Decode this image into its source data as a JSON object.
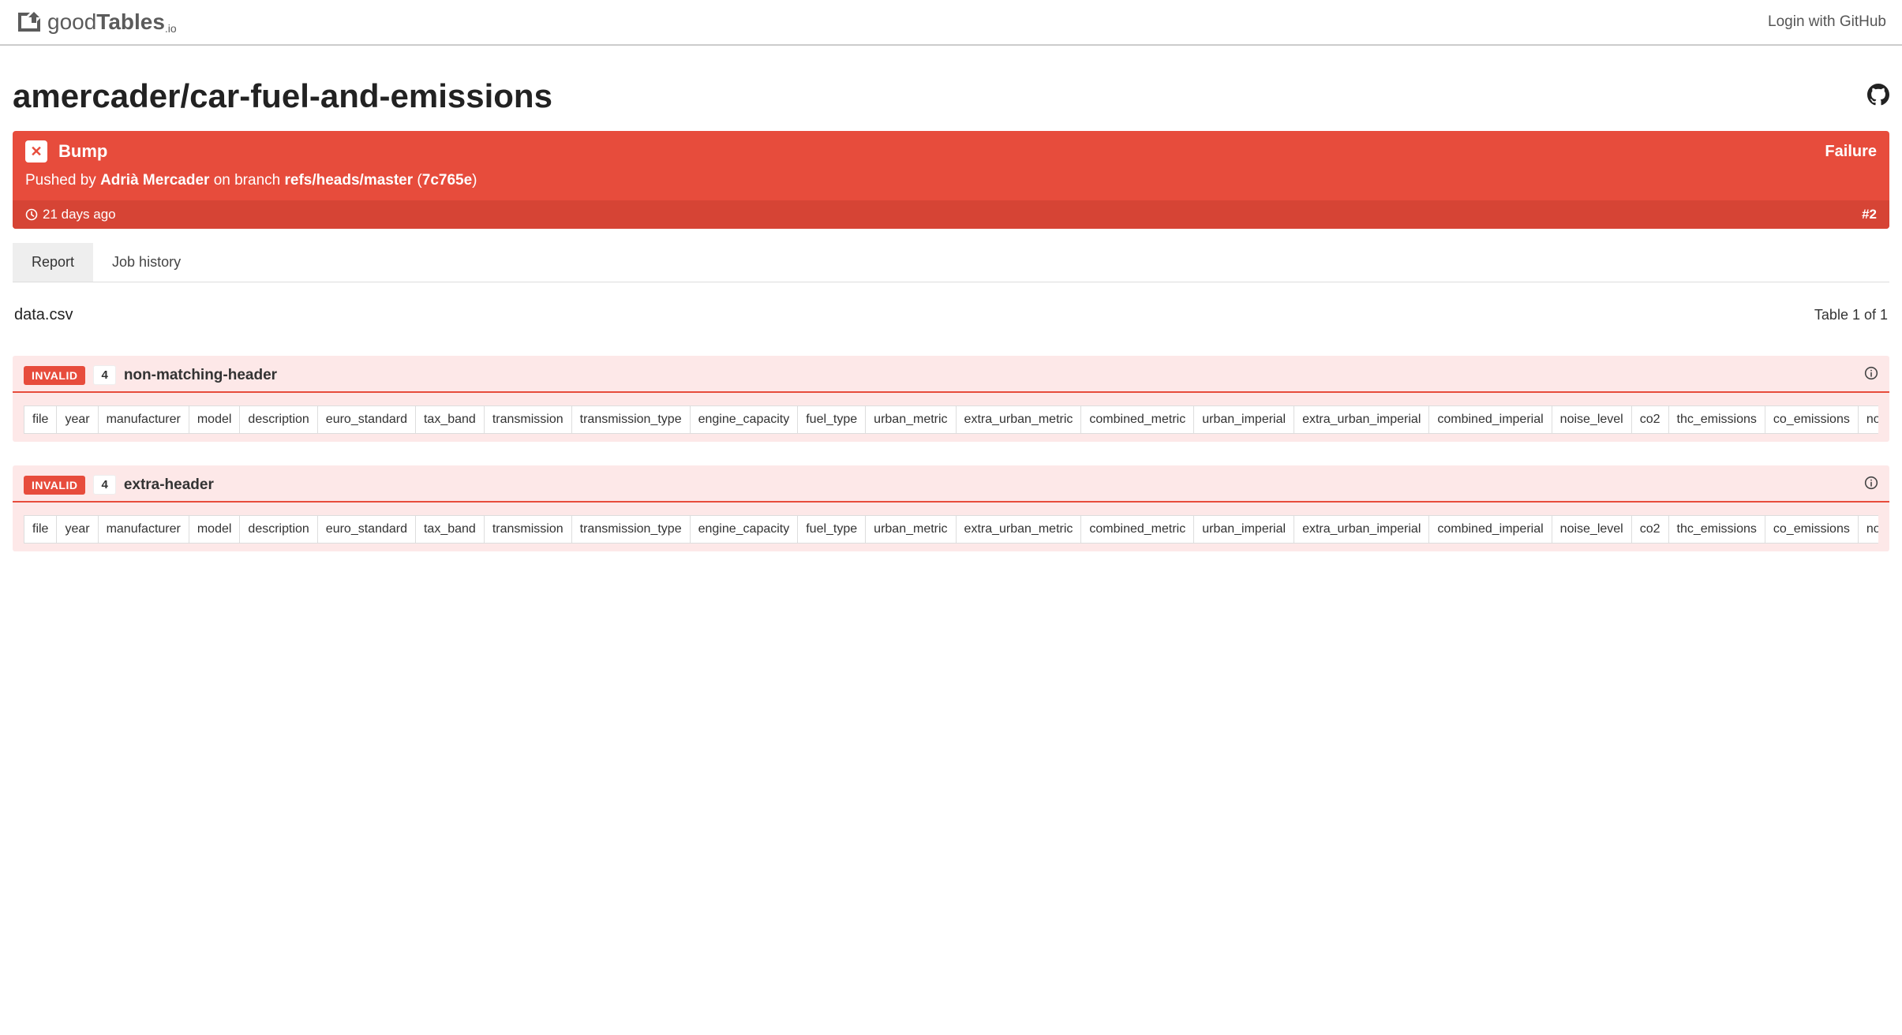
{
  "header": {
    "logo_text_prefix": "good",
    "logo_text_bold": "Tables",
    "logo_sub": ".io",
    "login": "Login with GitHub"
  },
  "repo": {
    "title": "amercader/car-fuel-and-emissions"
  },
  "status": {
    "commit_message": "Bump",
    "result": "Failure",
    "pushed_by_prefix": "Pushed by ",
    "author": "Adrià Mercader",
    "branch_prefix": " on branch ",
    "branch": "refs/heads/master",
    "sha_open": " (",
    "sha": "7c765e",
    "sha_close": ")",
    "time_ago": "21 days ago",
    "job_number": "#2"
  },
  "tabs": {
    "report": "Report",
    "history": "Job history"
  },
  "report": {
    "file": "data.csv",
    "table_of": "Table 1 of 1"
  },
  "errors": [
    {
      "badge": "INVALID",
      "count": "4",
      "type": "non-matching-header",
      "columns": [
        "file",
        "year",
        "manufacturer",
        "model",
        "description",
        "euro_standard",
        "tax_band",
        "transmission",
        "transmission_type",
        "engine_capacity",
        "fuel_type",
        "urban_metric",
        "extra_urban_metric",
        "combined_metric",
        "urban_imperial",
        "extra_urban_imperial",
        "combined_imperial",
        "noise_level",
        "co2",
        "thc_emissions",
        "co_emissions",
        "nox_emissions"
      ]
    },
    {
      "badge": "INVALID",
      "count": "4",
      "type": "extra-header",
      "columns": [
        "file",
        "year",
        "manufacturer",
        "model",
        "description",
        "euro_standard",
        "tax_band",
        "transmission",
        "transmission_type",
        "engine_capacity",
        "fuel_type",
        "urban_metric",
        "extra_urban_metric",
        "combined_metric",
        "urban_imperial",
        "extra_urban_imperial",
        "combined_imperial",
        "noise_level",
        "co2",
        "thc_emissions",
        "co_emissions",
        "nox_emissions"
      ]
    }
  ]
}
